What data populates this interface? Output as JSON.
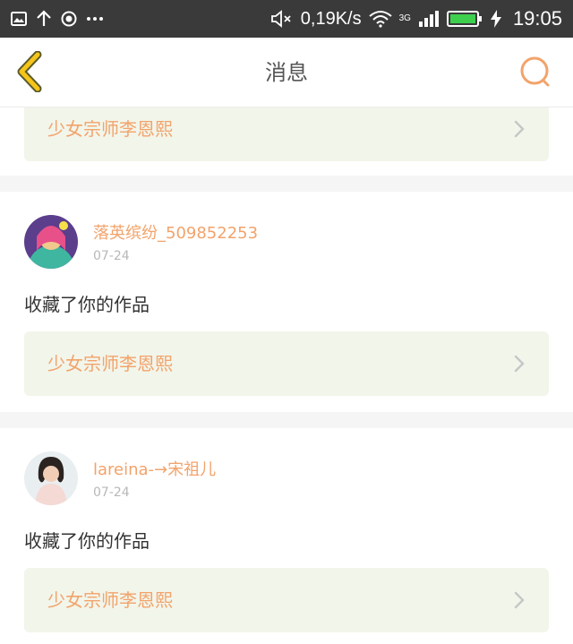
{
  "status_bar": {
    "speed": "0,19K/s",
    "network": "3G",
    "time": "19:05",
    "icons": [
      "image-icon",
      "upload-icon",
      "record-icon",
      "more-icon",
      "mute-icon",
      "wifi-icon",
      "signal-icon",
      "battery-icon",
      "charging-icon"
    ]
  },
  "header": {
    "title": "消息",
    "back_icon": "chevron-left-icon",
    "search_icon": "search-icon"
  },
  "colors": {
    "accent": "#f2a36b",
    "back_arrow": "#f5c51a",
    "card_bg": "#f2f5ea"
  },
  "messages": [
    {
      "work_title": "少女宗师李恩熙"
    },
    {
      "username": "落英缤纷_509852253",
      "date": "07-24",
      "action": "收藏了你的作品",
      "work_title": "少女宗师李恩熙"
    },
    {
      "username": "lareina-→宋祖儿",
      "date": "07-24",
      "action": "收藏了你的作品",
      "work_title": "少女宗师李恩熙"
    }
  ]
}
